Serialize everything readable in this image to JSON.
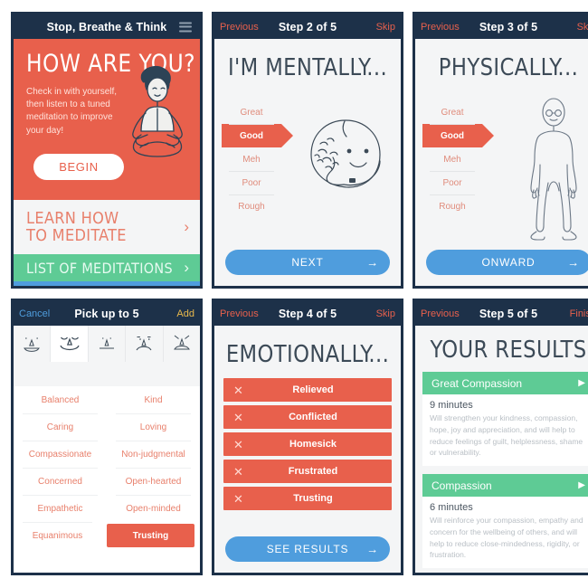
{
  "colors": {
    "navy": "#1d3149",
    "orange": "#e8604c",
    "green": "#5ecb95",
    "blue": "#4f9ddd",
    "yellow": "#e8b84b",
    "page_bg": "#f4f5f6"
  },
  "panel1": {
    "navbar": {
      "title": "Stop, Breathe & Think",
      "menu_icon": "hamburger-menu-icon"
    },
    "hero": {
      "heading": "HOW ARE YOU?",
      "subtext": "Check in with yourself, then listen to a tuned meditation to improve your day!",
      "begin_label": "BEGIN",
      "illustration": "meditating-woman-illustration"
    },
    "learn": {
      "line1": "LEARN HOW",
      "line2": "TO MEDITATE",
      "chevron": "chevron-right-icon"
    },
    "meditations": {
      "label": "LIST OF MEDITATIONS",
      "chevron": "chevron-right-icon"
    }
  },
  "panel2": {
    "navbar": {
      "previous": "Previous",
      "title": "Step 2 of 5",
      "skip": "Skip"
    },
    "heading": "I'M MENTALLY...",
    "scale": [
      "Great",
      "Good",
      "Meh",
      "Poor",
      "Rough"
    ],
    "selected": "Good",
    "illustration": "brain-blob-face-illustration",
    "cta": {
      "label": "NEXT",
      "arrow": "arrow-right-icon"
    }
  },
  "panel3": {
    "navbar": {
      "previous": "Previous",
      "title": "Step 3 of 5",
      "skip": "Skip"
    },
    "heading": "PHYSICALLY...",
    "scale": [
      "Great",
      "Good",
      "Meh",
      "Poor",
      "Rough"
    ],
    "selected": "Good",
    "illustration": "human-body-outline-illustration",
    "cta": {
      "label": "ONWARD",
      "arrow": "arrow-right-icon"
    }
  },
  "panel4": {
    "navbar": {
      "cancel": "Cancel",
      "title": "Pick up to 5",
      "add": "Add"
    },
    "faces": [
      "face-happy-icon",
      "face-smiling-icon",
      "face-neutral-icon",
      "face-sad-icon",
      "face-very-sad-icon"
    ],
    "selected_face_index": 1,
    "traits": [
      [
        "Balanced",
        "Kind"
      ],
      [
        "Caring",
        "Loving"
      ],
      [
        "Compassionate",
        "Non-judgmental"
      ],
      [
        "Concerned",
        "Open-hearted"
      ],
      [
        "Empathetic",
        "Open-minded"
      ],
      [
        "Equanimous",
        "Trusting"
      ]
    ],
    "selected_trait": "Trusting"
  },
  "panel5": {
    "navbar": {
      "previous": "Previous",
      "title": "Step 4 of 5",
      "skip": "Skip"
    },
    "heading": "EMOTIONALLY...",
    "emotions": [
      "Relieved",
      "Conflicted",
      "Homesick",
      "Frustrated",
      "Trusting"
    ],
    "remove_icon": "close-x-icon",
    "cta": {
      "label": "SEE RESULTS",
      "arrow": "arrow-right-icon"
    }
  },
  "panel6": {
    "navbar": {
      "previous": "Previous",
      "title": "Step 5 of 5",
      "finish": "Finish"
    },
    "heading": "YOUR RESULTS",
    "play_icon": "play-icon",
    "cards": [
      {
        "name": "Great Compassion",
        "duration": "9 minutes",
        "description": "Will strengthen your kindness, compassion, hope, joy and appreciation, and will help to reduce feelings of guilt, helplessness, shame or vulnerability."
      },
      {
        "name": "Compassion",
        "duration": "6 minutes",
        "description": "Will reinforce your compassion, empathy and concern for the wellbeing of others, and will help to reduce close-mindedness, rigidity, or frustration."
      }
    ]
  }
}
